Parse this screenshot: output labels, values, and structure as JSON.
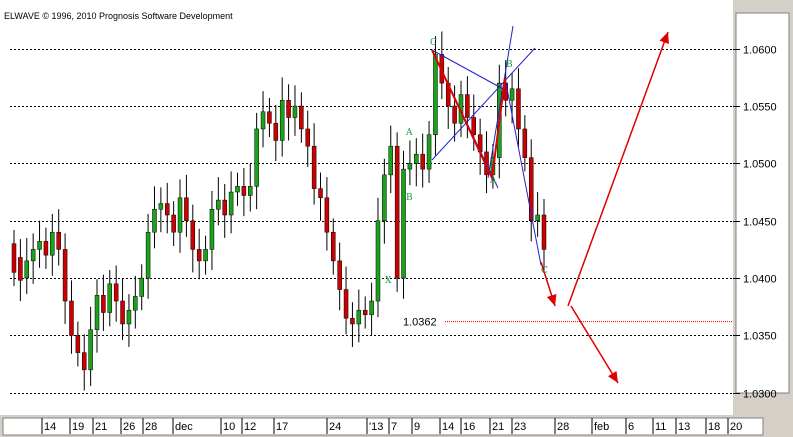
{
  "copyright": "ELWAVE © 1996, 2010 Prognosis Software Development",
  "colors": {
    "up_candle": "#1aa31a",
    "down_candle": "#cc0000",
    "wick": "#000000",
    "blue_lines": "#2222cc",
    "red_pattern": "#e00000",
    "projection_arrows": "#e00000",
    "target_line": "#e00000",
    "wave_labels": "#1a9a4a"
  },
  "chart_data": {
    "type": "candlestick",
    "instrument_hint": "EUR/USD-style daily",
    "ylim": [
      1.0285,
      1.0625
    ],
    "y_ticks": [
      "1.0600",
      "1.0550",
      "1.0500",
      "1.0450",
      "1.0400",
      "1.0350",
      "1.0300"
    ],
    "x_tick_labels": [
      "14",
      "19",
      "21",
      "26",
      "28",
      "dec",
      "10",
      "12",
      "17",
      "24",
      "'13",
      "7",
      "9",
      "14",
      "16",
      "21",
      "23",
      "28",
      "feb",
      "6",
      "11",
      "13",
      "18",
      "20"
    ],
    "grid": "horizontal dashed",
    "candles": [
      [
        1.043,
        1.0405
      ],
      [
        1.0418,
        1.0398
      ],
      [
        1.04,
        1.0415
      ],
      [
        1.0415,
        1.0425
      ],
      [
        1.0425,
        1.0432
      ],
      [
        1.0432,
        1.042
      ],
      [
        1.042,
        1.044
      ],
      [
        1.044,
        1.0425
      ],
      [
        1.0425,
        1.038
      ],
      [
        1.038,
        1.035
      ],
      [
        1.035,
        1.0335
      ],
      [
        1.0335,
        1.032
      ],
      [
        1.032,
        1.0355
      ],
      [
        1.0355,
        1.0385
      ],
      [
        1.0385,
        1.037
      ],
      [
        1.037,
        1.0395
      ],
      [
        1.0395,
        1.038
      ],
      [
        1.038,
        1.036
      ],
      [
        1.036,
        1.0372
      ],
      [
        1.0372,
        1.0384
      ],
      [
        1.0384,
        1.04
      ],
      [
        1.04,
        1.044
      ],
      [
        1.044,
        1.046
      ],
      [
        1.046,
        1.0465
      ],
      [
        1.0465,
        1.0455
      ],
      [
        1.0455,
        1.044
      ],
      [
        1.044,
        1.047
      ],
      [
        1.047,
        1.045
      ],
      [
        1.045,
        1.0425
      ],
      [
        1.0425,
        1.0415
      ],
      [
        1.0415,
        1.0425
      ],
      [
        1.0425,
        1.046
      ],
      [
        1.046,
        1.0468
      ],
      [
        1.0468,
        1.0455
      ],
      [
        1.0455,
        1.0475
      ],
      [
        1.0475,
        1.048
      ],
      [
        1.048,
        1.0472
      ],
      [
        1.0472,
        1.048
      ],
      [
        1.048,
        1.053
      ],
      [
        1.053,
        1.0545
      ],
      [
        1.0545,
        1.0535
      ],
      [
        1.0535,
        1.052
      ],
      [
        1.052,
        1.0555
      ],
      [
        1.0555,
        1.054
      ],
      [
        1.054,
        1.055
      ],
      [
        1.055,
        1.053
      ],
      [
        1.053,
        1.0515
      ],
      [
        1.0515,
        1.0478
      ],
      [
        1.0478,
        1.047
      ],
      [
        1.047,
        1.044
      ],
      [
        1.044,
        1.0415
      ],
      [
        1.0415,
        1.039
      ],
      [
        1.039,
        1.0365
      ],
      [
        1.0365,
        1.036
      ],
      [
        1.036,
        1.0372
      ],
      [
        1.0372,
        1.0368
      ],
      [
        1.0368,
        1.038
      ],
      [
        1.038,
        1.045
      ],
      [
        1.045,
        1.049
      ],
      [
        1.049,
        1.0515
      ],
      [
        1.0515,
        1.04
      ],
      [
        1.04,
        1.0495
      ],
      [
        1.0495,
        1.05
      ],
      [
        1.05,
        1.0508
      ],
      [
        1.0508,
        1.0495
      ],
      [
        1.0495,
        1.0525
      ],
      [
        1.0525,
        1.0595
      ],
      [
        1.0595,
        1.057
      ],
      [
        1.057,
        1.055
      ],
      [
        1.055,
        1.0535
      ],
      [
        1.0535,
        1.056
      ],
      [
        1.056,
        1.054
      ],
      [
        1.054,
        1.0525
      ],
      [
        1.0525,
        1.051
      ],
      [
        1.051,
        1.049
      ],
      [
        1.049,
        1.0505
      ],
      [
        1.0505,
        1.057
      ],
      [
        1.057,
        1.0555
      ],
      [
        1.0555,
        1.0565
      ],
      [
        1.0565,
        1.053
      ],
      [
        1.053,
        1.0505
      ],
      [
        1.0505,
        1.045
      ],
      [
        1.045,
        1.0455
      ],
      [
        1.0455,
        1.0425
      ]
    ],
    "target_label": "1.0362",
    "target_value": 1.0362,
    "wave_labels": [
      {
        "text": "C"
      },
      {
        "text": "A"
      },
      {
        "text": "B"
      },
      {
        "text": "X"
      },
      {
        "text": "B"
      },
      {
        "text": "A"
      },
      {
        "text": "C"
      }
    ]
  }
}
